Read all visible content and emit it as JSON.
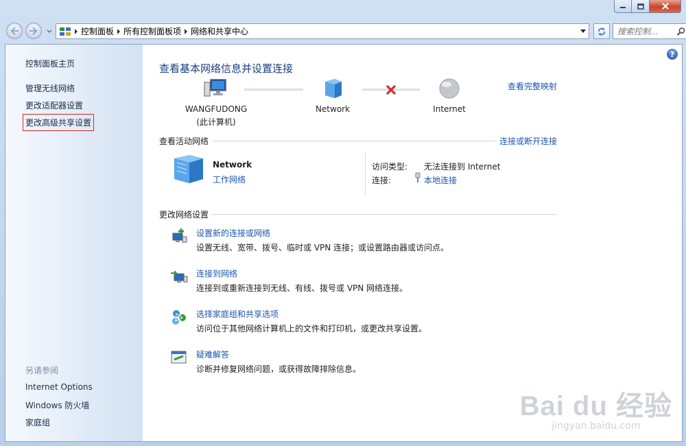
{
  "window": {
    "colors": {
      "title_text": "#1b3d80",
      "link": "#1c55b0",
      "close": "#c7462c"
    }
  },
  "address_bar": {
    "crumbs": [
      "控制面板",
      "所有控制面板项",
      "网络和共享中心"
    ],
    "search_placeholder": "搜索控制..."
  },
  "sidebar": {
    "home": "控制面板主页",
    "links": [
      "管理无线网络",
      "更改适配器设置",
      "更改高级共享设置"
    ],
    "see_also_title": "另请参阅",
    "see_also": [
      "Internet Options",
      "Windows 防火墙",
      "家庭组"
    ]
  },
  "main": {
    "title": "查看基本网络信息并设置连接",
    "full_map_link": "查看完整映射",
    "map": {
      "computer_name": "WANGFUDONG",
      "computer_sub": "(此计算机)",
      "network": "Network",
      "internet": "Internet"
    },
    "active_networks": {
      "heading": "查看活动网络",
      "connect_link": "连接或断开连接",
      "network_name": "Network",
      "network_type": "工作网络",
      "access_type_label": "访问类型:",
      "access_type_value": "无法连接到 Internet",
      "connections_label": "连接:",
      "connections_value": "本地连接"
    },
    "change_settings": {
      "heading": "更改网络设置",
      "tasks": [
        {
          "title": "设置新的连接或网络",
          "desc": "设置无线、宽带、拨号、临时或 VPN 连接；或设置路由器或访问点。",
          "icon": "new-connection-icon"
        },
        {
          "title": "连接到网络",
          "desc": "连接到或重新连接到无线、有线、拨号或 VPN 网络连接。",
          "icon": "connect-network-icon"
        },
        {
          "title": "选择家庭组和共享选项",
          "desc": "访问位于其他网络计算机上的文件和打印机，或更改共享设置。",
          "icon": "homegroup-icon"
        },
        {
          "title": "疑难解答",
          "desc": "诊断并修复网络问题，或获得故障排除信息。",
          "icon": "troubleshoot-icon"
        }
      ]
    }
  },
  "watermark": {
    "brand": "Bai du 经验",
    "url": "jingyan.baidu.com"
  }
}
